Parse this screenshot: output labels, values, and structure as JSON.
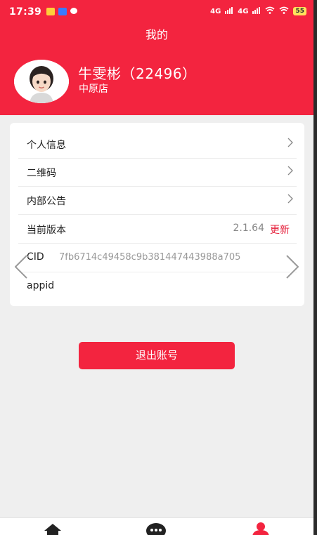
{
  "status_bar": {
    "time": "17:39",
    "network_1": "4G",
    "network_2": "4G",
    "battery": "55"
  },
  "header": {
    "title": "我的",
    "user_name": "牛雯彬（22496）",
    "store_name": "中原店"
  },
  "menu": {
    "items": [
      {
        "label": "个人信息"
      },
      {
        "label": "二维码"
      },
      {
        "label": "内部公告"
      }
    ],
    "version": {
      "label": "当前版本",
      "value": "2.1.64",
      "update_label": "更新"
    },
    "cid": {
      "label": "CID",
      "value": "7fb6714c49458c9b381447443988a705"
    },
    "appid": {
      "label": "appid"
    }
  },
  "logout_label": "退出账号",
  "tabbar": {
    "icons": [
      "home-icon",
      "chat-icon",
      "profile-icon"
    ],
    "accent": "#f3243f"
  },
  "colors": {
    "brand_red": "#f3243f",
    "background": "#efefef"
  }
}
